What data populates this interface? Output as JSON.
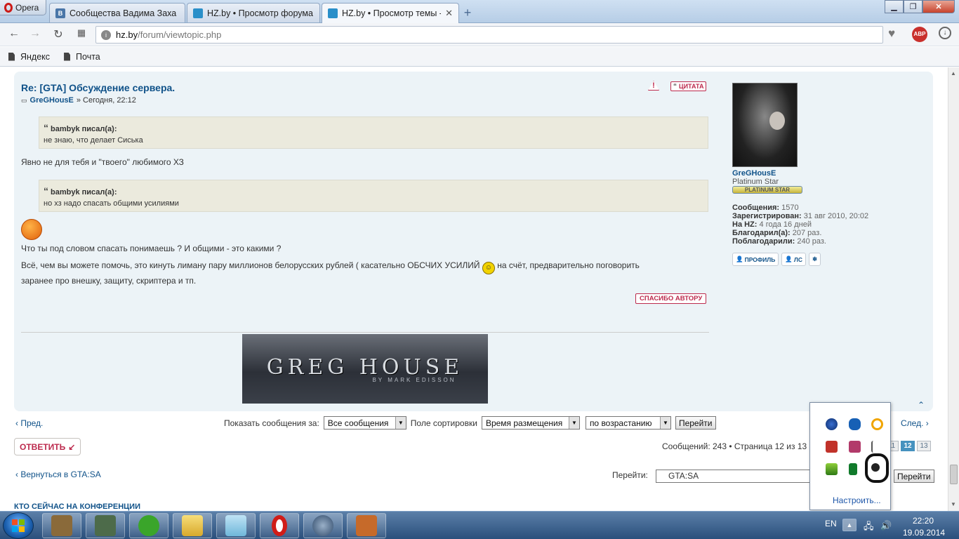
{
  "browser": {
    "menu_label": "Opera",
    "tabs": [
      {
        "title": "Сообщества Вадима Заха",
        "active": false
      },
      {
        "title": "HZ.by • Просмотр форума",
        "active": false
      },
      {
        "title": "HZ.by • Просмотр темы -",
        "active": true
      }
    ],
    "url_host": "hz.by",
    "url_path": "/forum/viewtopic.php",
    "abp_label": "ABP",
    "bookmarks": [
      "Яндекс",
      "Почта"
    ]
  },
  "post": {
    "title": "Re: [GTA] Обсуждение сервера.",
    "author": "GreGHousE",
    "time": "» Сегодня, 22:12",
    "quote_button": "ЦИТАТА",
    "quotes": [
      {
        "header": "bambyk писал(а):",
        "text": "не знаю, что делает Сиська"
      },
      {
        "header": "bambyk писал(а):",
        "text": "но хз надо спасать общими усилиями"
      }
    ],
    "reply1": "Явно не для тебя и \"твоего\" любимого ХЗ",
    "line2": "Что ты под словом спасать понимаешь ? И общими - это какими ?",
    "line3a": "Всё, чем вы можете помочь, это кинуть лиману пару миллионов белорусских рублей ( касательно ОБСЧИХ УСИЛИЙ",
    "line3b": " на счёт, предварительно поговорить",
    "line4": "заранее про внешку, защиту, скриптера и тп.",
    "thanks_button": "СПАСИБО АВТОРУ",
    "signature_main": "GREG HOUSE",
    "signature_sub": "BY MARK EDISSON"
  },
  "profile": {
    "name": "GreGHousE",
    "rank": "Platinum Star",
    "badge": "PLATINUM STAR",
    "messages_label": "Сообщения:",
    "messages": "1570",
    "registered_label": "Зарегистрирован:",
    "registered": "31 авг 2010, 20:02",
    "onhz_label": "На HZ:",
    "onhz": "4 года 16 дней",
    "thanked_label": "Благодарил(а):",
    "thanked": "207 раз.",
    "gotthanks_label": "Поблагодарили:",
    "gotthanks": "240 раз.",
    "btn_profile": "ПРОФИЛЬ",
    "btn_pm": "ЛС"
  },
  "nav": {
    "prev": "Пред.",
    "next": "След.",
    "show_label": "Показать сообщения за:",
    "show_value": "Все сообщения",
    "sort_label": "Поле сортировки",
    "sort_value": "Время размещения",
    "order_value": "по возрастанию",
    "go": "Перейти",
    "reply_button": "ОТВЕТИТЬ",
    "pagination": "Сообщений: 243 • Страница 12 из 13",
    "pages": [
      "11",
      "12",
      "13"
    ],
    "current_page": "12",
    "back_link": "Вернуться в GTA:SA",
    "jump_label": "Перейти:",
    "jump_value": "GTA:SA",
    "jump_go": "Перейти",
    "who_online": "КТО СЕЙЧАС НА КОНФЕРЕНЦИИ"
  },
  "tray_popup": {
    "customize": "Настроить..."
  },
  "taskbar": {
    "lang": "EN",
    "time": "22:20",
    "date": "19.09.2014"
  },
  "colors": {
    "link": "#105289",
    "accent_red": "#bc2a4d",
    "post_bg": "#ecf3f7",
    "quote_bg": "#ebeadd"
  }
}
